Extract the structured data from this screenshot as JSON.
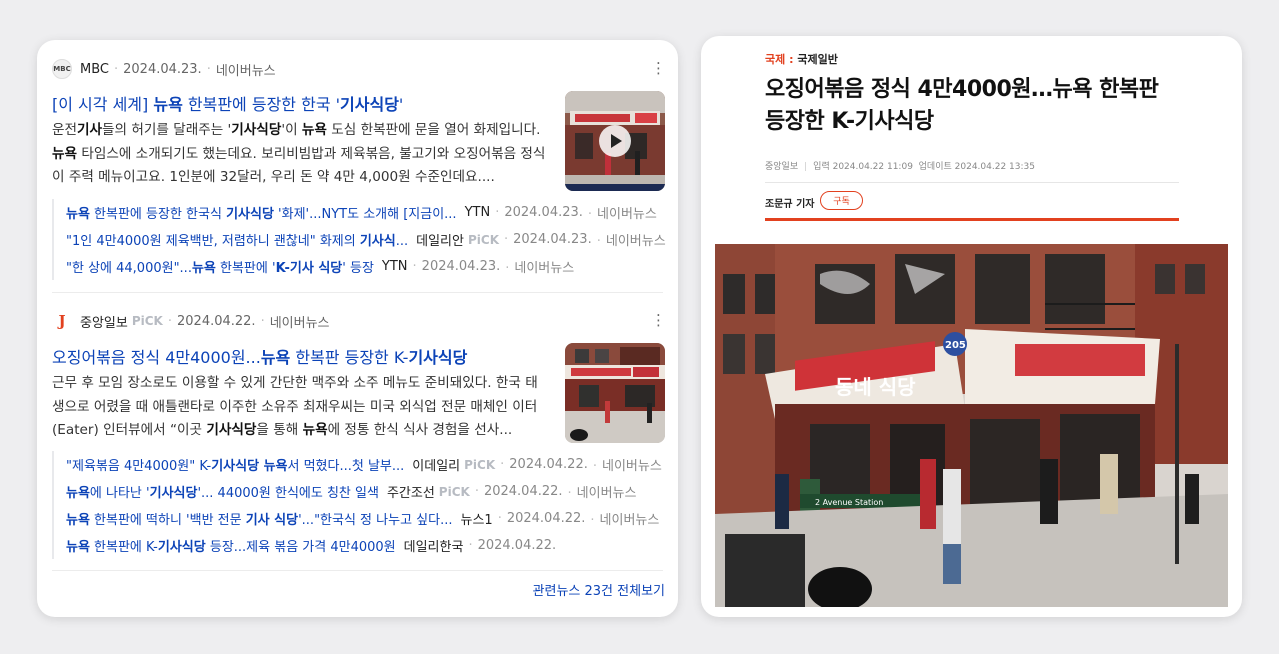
{
  "left": {
    "cluster1": {
      "logo": "MBC",
      "press": "MBC",
      "date": "2024.04.23.",
      "portal": "네이버뉴스",
      "title_html": "[이 시각 세계] <b>뉴욕</b> 한복판에 등장한 한국 '<b>기사식당</b>'",
      "desc_html": "운전<b>기사</b>들의 허기를 달래주는 '<b>기사식당</b>'이 <b>뉴욕</b> 도심 한복판에 문을 열어 화제입니다. <b>뉴욕</b> 타임스에 소개되기도 했는데요. 보리비빔밥과 제육볶음, 불고기와 오징어볶음 정식이 주력 메뉴이고요. 1인분에 32달러, 우리 돈 약 4만 4,000원 수준인데요....",
      "related": [
        {
          "title_html": "<b>뉴욕</b> 한복판에 등장한 한국식 <b>기사식당</b> '화제'...NYT도 소개해 [지금이...",
          "press": "YTN",
          "pick": "",
          "date": "2024.04.23.",
          "portal": "네이버뉴스"
        },
        {
          "title_html": "\"1인 4만4000원 제육백반, 저렴하니 괜찮네\" 화제의 <b>기사식</b>...",
          "press": "데일리안",
          "pick": "PiCK",
          "date": "2024.04.23.",
          "portal": "네이버뉴스"
        },
        {
          "title_html": "\"한 상에 44,000원\"...<b>뉴욕</b> 한복판에 '<b>K-기사 식당</b>' 등장",
          "press": "YTN",
          "pick": "",
          "date": "2024.04.23.",
          "portal": "네이버뉴스"
        }
      ]
    },
    "cluster2": {
      "logo": "J",
      "press": "중앙일보",
      "pick": "PiCK",
      "date": "2024.04.22.",
      "portal": "네이버뉴스",
      "title_html": "오징어볶음 정식 4만4000원...<b>뉴욕</b> 한복판 등장한 K-<b>기사식당</b>",
      "desc_html": "근무 후 모임 장소로도 이용할 수 있게 간단한 맥주와 소주 메뉴도 준비돼있다. 한국 태생으로 어렸을 때 애틀랜타로 이주한 소유주 최재우씨는 미국 외식업 전문 매체인 이터(Eater) 인터뷰에서 “이곳 <b>기사식당</b>을 통해 <b>뉴욕</b>에 정통 한식 식사 경험을 선사...",
      "related": [
        {
          "title_html": "\"제육볶음 4만4000원\" K-<b>기사식당 뉴욕</b>서 먹혔다...첫 날부...",
          "press": "이데일리",
          "pick": "PiCK",
          "date": "2024.04.22.",
          "portal": "네이버뉴스"
        },
        {
          "title_html": "<b>뉴욕</b>에 나타난 '<b>기사식당</b>'... 44000원 한식에도 칭찬 일색",
          "press": "주간조선",
          "pick": "PiCK",
          "date": "2024.04.22.",
          "portal": "네이버뉴스"
        },
        {
          "title_html": "<b>뉴욕</b> 한복판에 떡하니 '백반 전문 <b>기사 식당</b>'...\"한국식 정 나누고 싶다...",
          "press": "뉴스1",
          "pick": "",
          "date": "2024.04.22.",
          "portal": "네이버뉴스"
        },
        {
          "title_html": "<b>뉴욕</b> 한복판에 K-<b>기사식당</b> 등장...제육 볶음 가격 4만4000원",
          "press": "데일리한국",
          "pick": "",
          "date": "2024.04.22.",
          "portal": ""
        }
      ]
    },
    "all_related": "관련뉴스 23건 전체보기"
  },
  "right": {
    "category_main": "국제",
    "category_sep": ":",
    "category_sub": "국제일반",
    "title": "오징어볶음 정식 4만4000원…뉴욕 한복판 등장한 K-기사식당",
    "publisher": "중앙일보",
    "published": "입력 2024.04.22 11:09",
    "updated": "업데이트 2024.04.22 13:35",
    "reporter": "조문규 기자",
    "subscribe": "구독"
  },
  "photo_signs": {
    "main_sign": "동네 식당",
    "sign_205": "205",
    "subway": "2 Avenue Station"
  },
  "colors": {
    "link": "#0c43b7",
    "accent": "#e2411f"
  }
}
